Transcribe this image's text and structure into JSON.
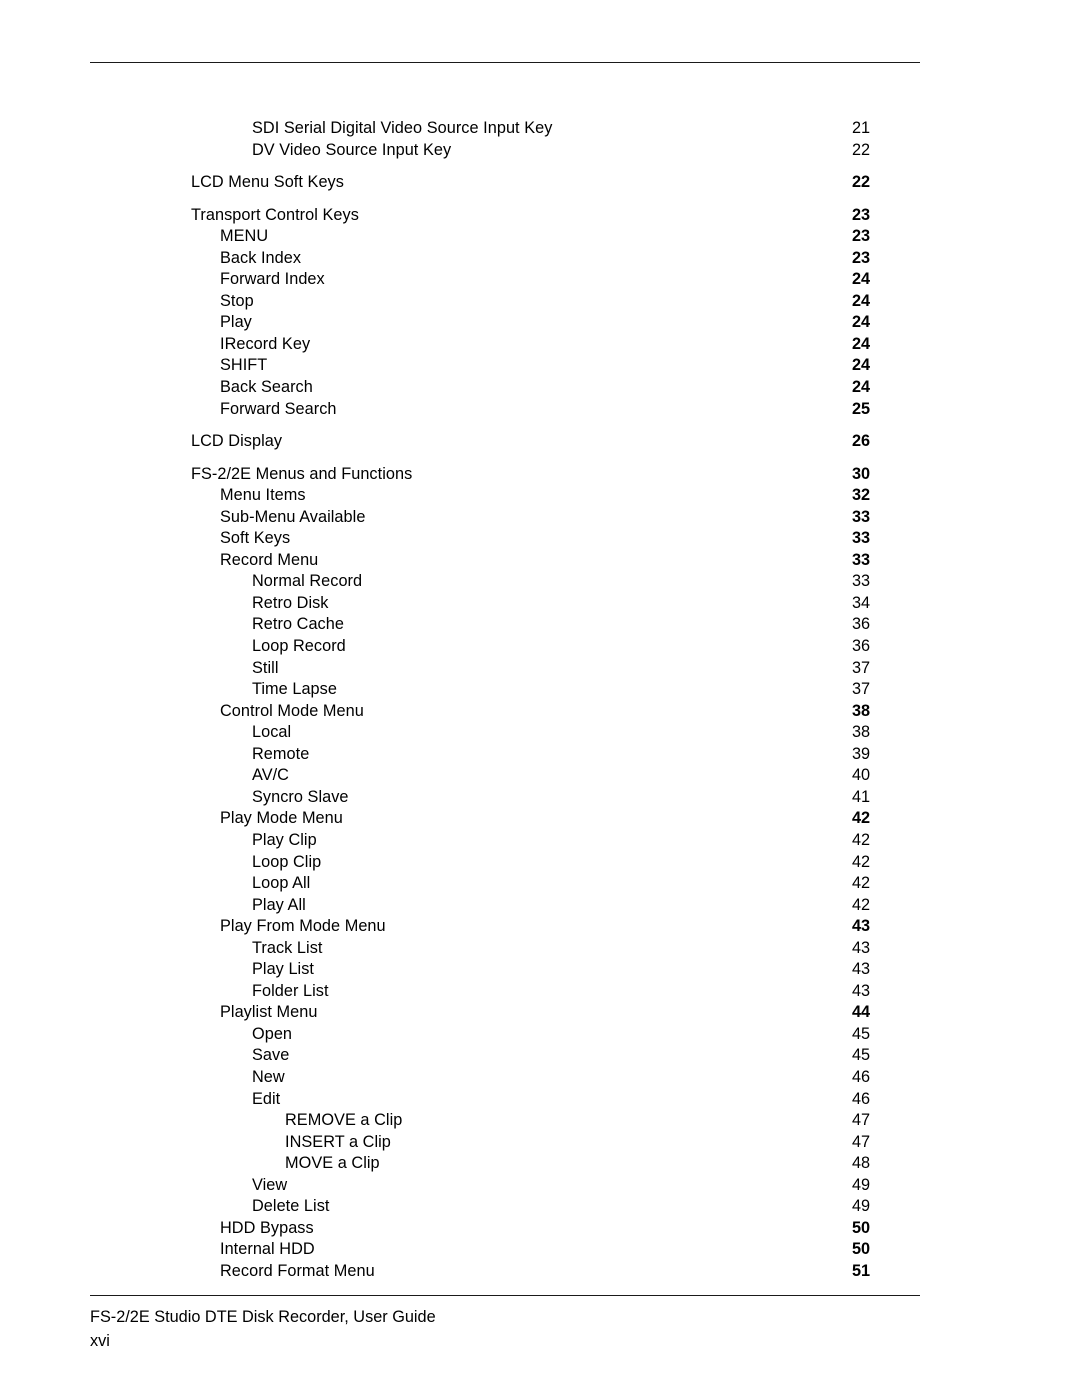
{
  "document": {
    "footer_title": "FS-2/2E Studio DTE Disk Recorder, User Guide",
    "page_label": "xvi"
  },
  "toc": {
    "entries": [
      {
        "label": "SDI Serial Digital Video Source Input Key",
        "page": "21",
        "level": 3,
        "bold": false,
        "gap": false
      },
      {
        "label": "DV Video Source Input Key",
        "page": "22",
        "level": 3,
        "bold": false,
        "gap": false
      },
      {
        "label": "LCD Menu Soft Keys",
        "page": "22",
        "level": 1,
        "bold": true,
        "gap": true
      },
      {
        "label": "Transport Control Keys",
        "page": "23",
        "level": 1,
        "bold": true,
        "gap": true
      },
      {
        "label": "MENU",
        "page": "23",
        "level": 2,
        "bold": true,
        "gap": false
      },
      {
        "label": "Back Index",
        "page": "23",
        "level": 2,
        "bold": true,
        "gap": false
      },
      {
        "label": "Forward Index",
        "page": "24",
        "level": 2,
        "bold": true,
        "gap": false
      },
      {
        "label": "Stop",
        "page": "24",
        "level": 2,
        "bold": true,
        "gap": false
      },
      {
        "label": "Play",
        "page": "24",
        "level": 2,
        "bold": true,
        "gap": false
      },
      {
        "label": "IRecord Key",
        "page": "24",
        "level": 2,
        "bold": true,
        "gap": false
      },
      {
        "label": "SHIFT",
        "page": "24",
        "level": 2,
        "bold": true,
        "gap": false
      },
      {
        "label": "Back Search",
        "page": "24",
        "level": 2,
        "bold": true,
        "gap": false
      },
      {
        "label": "Forward Search",
        "page": "25",
        "level": 2,
        "bold": true,
        "gap": false
      },
      {
        "label": "LCD Display",
        "page": "26",
        "level": 1,
        "bold": true,
        "gap": true
      },
      {
        "label": "FS-2/2E Menus and Functions",
        "page": "30",
        "level": 1,
        "bold": true,
        "gap": true
      },
      {
        "label": "Menu Items",
        "page": "32",
        "level": 2,
        "bold": true,
        "gap": false
      },
      {
        "label": "Sub-Menu Available",
        "page": "33",
        "level": 2,
        "bold": true,
        "gap": false
      },
      {
        "label": "Soft Keys",
        "page": "33",
        "level": 2,
        "bold": true,
        "gap": false
      },
      {
        "label": "Record Menu",
        "page": "33",
        "level": 2,
        "bold": true,
        "gap": false
      },
      {
        "label": "Normal Record",
        "page": "33",
        "level": 3,
        "bold": false,
        "gap": false
      },
      {
        "label": "Retro Disk",
        "page": "34",
        "level": 3,
        "bold": false,
        "gap": false
      },
      {
        "label": "Retro Cache",
        "page": "36",
        "level": 3,
        "bold": false,
        "gap": false
      },
      {
        "label": "Loop Record",
        "page": "36",
        "level": 3,
        "bold": false,
        "gap": false
      },
      {
        "label": "Still",
        "page": "37",
        "level": 3,
        "bold": false,
        "gap": false
      },
      {
        "label": "Time Lapse",
        "page": "37",
        "level": 3,
        "bold": false,
        "gap": false
      },
      {
        "label": "Control Mode Menu",
        "page": "38",
        "level": 2,
        "bold": true,
        "gap": false
      },
      {
        "label": "Local",
        "page": "38",
        "level": 3,
        "bold": false,
        "gap": false
      },
      {
        "label": "Remote",
        "page": "39",
        "level": 3,
        "bold": false,
        "gap": false
      },
      {
        "label": "AV/C",
        "page": "40",
        "level": 3,
        "bold": false,
        "gap": false
      },
      {
        "label": "Syncro Slave",
        "page": "41",
        "level": 3,
        "bold": false,
        "gap": false
      },
      {
        "label": "Play Mode Menu",
        "page": "42",
        "level": 2,
        "bold": true,
        "gap": false
      },
      {
        "label": "Play Clip",
        "page": "42",
        "level": 3,
        "bold": false,
        "gap": false
      },
      {
        "label": "Loop Clip",
        "page": "42",
        "level": 3,
        "bold": false,
        "gap": false
      },
      {
        "label": "Loop All",
        "page": "42",
        "level": 3,
        "bold": false,
        "gap": false
      },
      {
        "label": "Play All",
        "page": "42",
        "level": 3,
        "bold": false,
        "gap": false
      },
      {
        "label": "Play From Mode Menu",
        "page": "43",
        "level": 2,
        "bold": true,
        "gap": false
      },
      {
        "label": "Track List",
        "page": "43",
        "level": 3,
        "bold": false,
        "gap": false
      },
      {
        "label": "Play List",
        "page": "43",
        "level": 3,
        "bold": false,
        "gap": false
      },
      {
        "label": "Folder List",
        "page": "43",
        "level": 3,
        "bold": false,
        "gap": false
      },
      {
        "label": "Playlist Menu",
        "page": "44",
        "level": 2,
        "bold": true,
        "gap": false
      },
      {
        "label": "Open",
        "page": "45",
        "level": 3,
        "bold": false,
        "gap": false
      },
      {
        "label": "Save",
        "page": "45",
        "level": 3,
        "bold": false,
        "gap": false
      },
      {
        "label": "New",
        "page": "46",
        "level": 3,
        "bold": false,
        "gap": false
      },
      {
        "label": "Edit",
        "page": "46",
        "level": 3,
        "bold": false,
        "gap": false
      },
      {
        "label": "REMOVE a Clip",
        "page": "47",
        "level": 4,
        "bold": false,
        "gap": false
      },
      {
        "label": "INSERT a Clip",
        "page": "47",
        "level": 4,
        "bold": false,
        "gap": false
      },
      {
        "label": "MOVE a Clip",
        "page": "48",
        "level": 4,
        "bold": false,
        "gap": false
      },
      {
        "label": "View",
        "page": "49",
        "level": 3,
        "bold": false,
        "gap": false
      },
      {
        "label": "Delete List",
        "page": "49",
        "level": 3,
        "bold": false,
        "gap": false
      },
      {
        "label": "HDD Bypass",
        "page": "50",
        "level": 2,
        "bold": true,
        "gap": false
      },
      {
        "label": "Internal HDD",
        "page": "50",
        "level": 2,
        "bold": true,
        "gap": false
      },
      {
        "label": "Record Format Menu",
        "page": "51",
        "level": 2,
        "bold": true,
        "gap": false
      }
    ]
  }
}
